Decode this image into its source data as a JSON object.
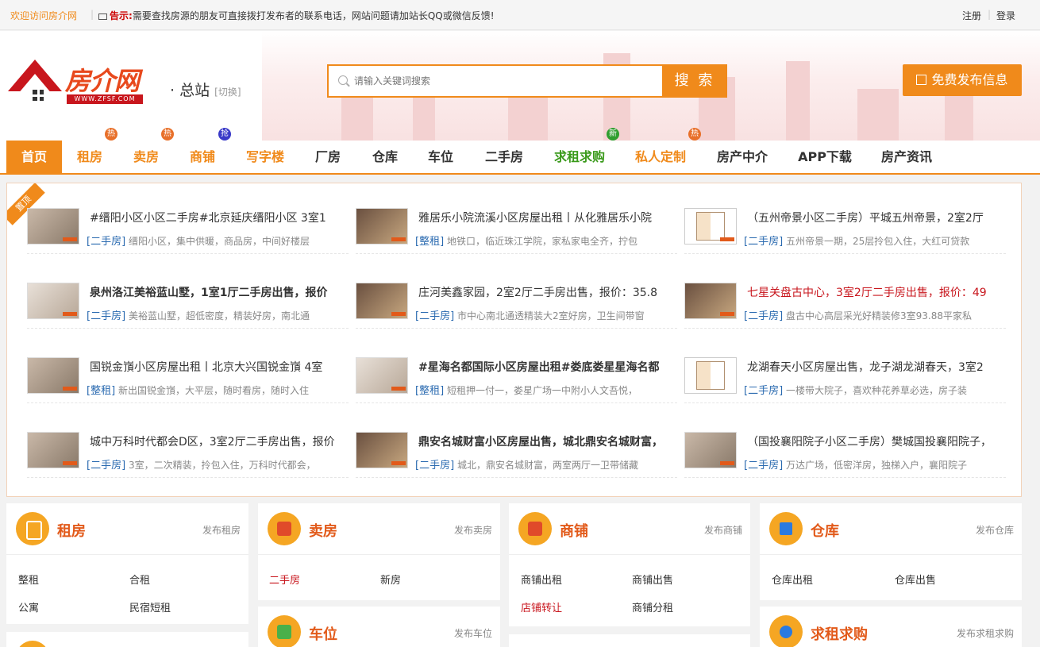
{
  "topbar": {
    "welcome": "欢迎访问房介网",
    "notice_label": "告示:",
    "notice_text": "需要查找房源的朋友可直接拨打发布者的联系电话，网站问题请加站长QQ或微信反馈!",
    "register": "注册",
    "login": "登录"
  },
  "header": {
    "logo_name": "房介网",
    "logo_url": "WWW.ZFSF.COM",
    "station": "· 总站",
    "station_switch": "[切换]",
    "search_placeholder": "请输入关键词搜索",
    "search_button": "搜 索",
    "publish_button": "免费发布信息"
  },
  "nav": [
    {
      "label": "首页",
      "badge": ""
    },
    {
      "label": "租房",
      "badge": "热"
    },
    {
      "label": "卖房",
      "badge": "热"
    },
    {
      "label": "商铺",
      "badge": "抢"
    },
    {
      "label": "写字楼",
      "badge": ""
    },
    {
      "label": "厂房",
      "badge": ""
    },
    {
      "label": "仓库",
      "badge": ""
    },
    {
      "label": "车位",
      "badge": ""
    },
    {
      "label": "二手房",
      "badge": ""
    },
    {
      "label": "求租求购",
      "badge": "新"
    },
    {
      "label": "私人定制",
      "badge": "热"
    },
    {
      "label": "房产中介",
      "badge": ""
    },
    {
      "label": "APP下载",
      "badge": ""
    },
    {
      "label": "房产资讯",
      "badge": ""
    }
  ],
  "featured": {
    "ribbon": "置顶",
    "listings": [
      {
        "title": "#缙阳小区小区二手房#北京延庆缙阳小区 3室1",
        "kind": "[二手房]",
        "desc": "缙阳小区，集中供暖，商品房，中间好楼层"
      },
      {
        "title": "雅居乐小院流溪小区房屋出租丨从化雅居乐小院",
        "kind": "[整租]",
        "desc": "地铁口，临近珠江学院，家私家电全齐，拧包"
      },
      {
        "title": "（五州帝景小区二手房）平城五州帝景，2室2厅",
        "kind": "[二手房]",
        "desc": "五州帝景一期，25层拎包入住，大红可贷款"
      },
      {
        "title": "泉州洛江美裕蓝山墅，1室1厅二手房出售，报价",
        "kind": "[二手房]",
        "desc": "美裕蓝山墅，超低密度，精装好房，南北通"
      },
      {
        "title": "庄河美鑫家园，2室2厅二手房出售，报价：35.8",
        "kind": "[二手房]",
        "desc": "市中心南北通透精装大2室好房，卫生间带窗"
      },
      {
        "title": "七星关盘古中心，3室2厅二手房出售，报价：49",
        "kind": "[二手房]",
        "desc": "盘古中心高层采光好精装修3室93.88平家私"
      },
      {
        "title": "国锐金嵿小区房屋出租丨北京大兴国锐金嵿 4室",
        "kind": "[整租]",
        "desc": "新出国锐金嵿，大平层，随时看房，随时入住"
      },
      {
        "title": "#星海名都国际小区房屋出租#娄底娄星星海名都",
        "kind": "[整租]",
        "desc": "短租押一付一，娄星广场一中附小人文吾悦，"
      },
      {
        "title": "龙湖春天小区房屋出售，龙子湖龙湖春天，3室2",
        "kind": "[二手房]",
        "desc": "一楼带大院子，喜欢种花养草必选，房子装"
      },
      {
        "title": "城中万科时代都会D区，3室2厅二手房出售，报价",
        "kind": "[二手房]",
        "desc": "3室，二次精装，拎包入住，万科时代都会，"
      },
      {
        "title": "鼎安名城财富小区房屋出售，城北鼎安名城财富，",
        "kind": "[二手房]",
        "desc": "城北，鼎安名城财富，两室两厅一卫带储藏"
      },
      {
        "title": "（国投襄阳院子小区二手房）樊城国投襄阳院子，",
        "kind": "[二手房]",
        "desc": "万达广场，低密洋房，独梯入户，襄阳院子"
      }
    ]
  },
  "categories": {
    "rent": {
      "name": "租房",
      "publish": "发布租房",
      "links": [
        "整租",
        "合租",
        "公寓",
        "民宿短租"
      ]
    },
    "sell": {
      "name": "卖房",
      "publish": "发布卖房",
      "links": [
        "二手房",
        "新房"
      ]
    },
    "shop": {
      "name": "商铺",
      "publish": "发布商铺",
      "links": [
        "商铺出租",
        "商铺出售",
        "店铺转让",
        "商铺分租"
      ]
    },
    "warehouse": {
      "name": "仓库",
      "publish": "发布仓库",
      "links": [
        "仓库出租",
        "仓库出售"
      ]
    },
    "parking": {
      "name": "车位",
      "publish": "发布车位"
    },
    "wanted": {
      "name": "求租求购",
      "publish": "发布求租求购"
    }
  },
  "colors": {
    "accent": "#f08a1b",
    "link_blue": "#2a6ab0",
    "hot_red": "#c8161d",
    "green": "#3a9a1b"
  }
}
